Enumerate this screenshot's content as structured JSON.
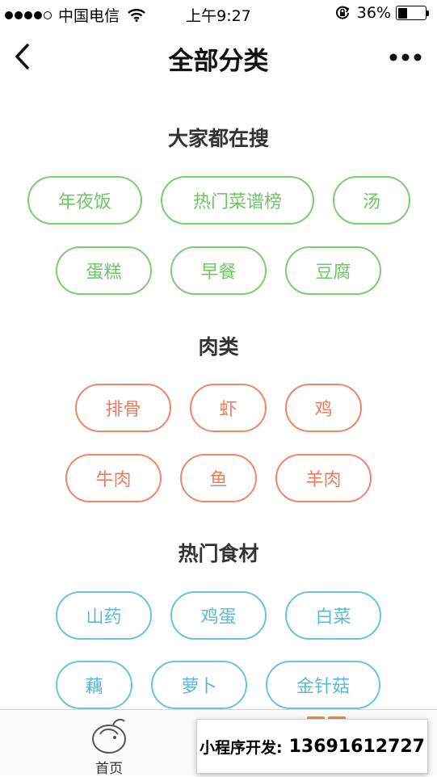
{
  "status_bar": {
    "carrier": "中国电信",
    "time": "上午9:27",
    "battery": "36%",
    "battery_level": 0.36,
    "signal_bars_filled": 4,
    "signal_bars_total": 5
  },
  "nav": {
    "title": "全部分类",
    "back_icon": "chevron-left-icon",
    "more_icon": "more-dots-icon"
  },
  "sections": [
    {
      "title": "大家都在搜",
      "color": "#6fc568",
      "tags": [
        "年夜饭",
        "热门菜谱榜",
        "汤",
        "蛋糕",
        "早餐",
        "豆腐"
      ]
    },
    {
      "title": "肉类",
      "color": "#f07a5c",
      "tags": [
        "排骨",
        "虾",
        "鸡",
        "牛肉",
        "鱼",
        "羊肉"
      ]
    },
    {
      "title": "热门食材",
      "color": "#5bb9d8",
      "tags": [
        "山药",
        "鸡蛋",
        "白菜",
        "藕",
        "萝卜",
        "金针菇"
      ]
    }
  ],
  "tab_bar": {
    "home_label": "首页",
    "home_icon": "bean-logo-icon"
  },
  "promo": {
    "label": "小程序开发:",
    "phone": "13691612727"
  }
}
